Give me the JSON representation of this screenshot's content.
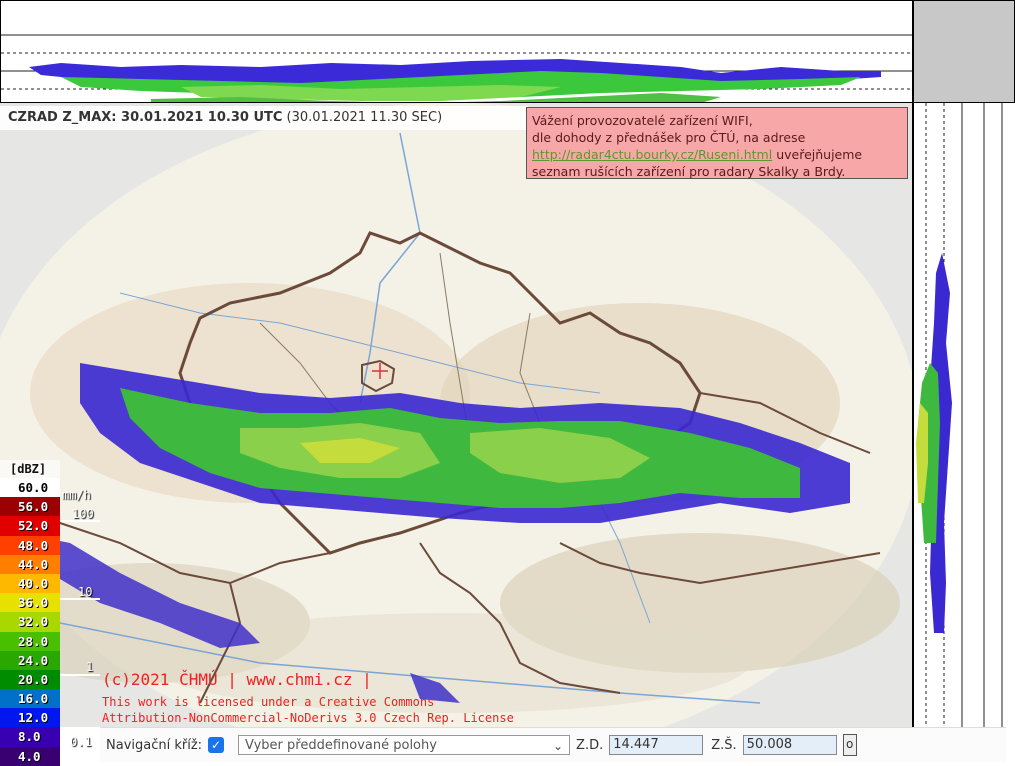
{
  "title": {
    "product": "CZRAD Z_MAX: 30.01.2021 10.30 UTC",
    "local_time": "(30.01.2021 11.30 SEC)"
  },
  "notice": {
    "line1": "Vážení provozovatelé zařízení WIFI,",
    "line2": "dle dohody z přednášek pro ČTÚ, na adrese",
    "link": "http://radar4ctu.bourky.cz/Ruseni.html",
    "line3_suffix": " uveřejňujeme",
    "line4": "seznam rušících zařízení pro radary Skalky a Brdy."
  },
  "legend": {
    "unit": "[dBZ]",
    "items": [
      {
        "label": "60.0",
        "color": "#ffffff",
        "text_color": "#000000"
      },
      {
        "label": "56.0",
        "color": "#9c0000",
        "text_color": "#ffffff"
      },
      {
        "label": "52.0",
        "color": "#e00000",
        "text_color": "#ffffff"
      },
      {
        "label": "48.0",
        "color": "#ff4000",
        "text_color": "#ffffff"
      },
      {
        "label": "44.0",
        "color": "#ff8000",
        "text_color": "#ffffff"
      },
      {
        "label": "40.0",
        "color": "#ffb800",
        "text_color": "#ffffff"
      },
      {
        "label": "36.0",
        "color": "#e8e000",
        "text_color": "#ffffff"
      },
      {
        "label": "32.0",
        "color": "#a8d800",
        "text_color": "#ffffff"
      },
      {
        "label": "28.0",
        "color": "#48c000",
        "text_color": "#ffffff"
      },
      {
        "label": "24.0",
        "color": "#28a800",
        "text_color": "#ffffff"
      },
      {
        "label": "20.0",
        "color": "#008c00",
        "text_color": "#ffffff"
      },
      {
        "label": "16.0",
        "color": "#0070c8",
        "text_color": "#ffffff"
      },
      {
        "label": "12.0",
        "color": "#0018f0",
        "text_color": "#ffffff"
      },
      {
        "label": "8.0",
        "color": "#3800b0",
        "text_color": "#ffffff"
      },
      {
        "label": "4.0",
        "color": "#380070",
        "text_color": "#ffffff"
      }
    ]
  },
  "rain_scale": {
    "unit": "mm/h",
    "labels": [
      "100",
      "10",
      "1",
      "0.1"
    ]
  },
  "copyright": "(c)2021 ČHMÚ | www.chmi.cz |",
  "license_line1": "This work is licensed under a Creative Commons",
  "license_line2": "Attribution-NonCommercial-NoDerivs 3.0 Czech Rep. License",
  "nav": {
    "label": "Navigační kříž:",
    "checked": true,
    "select_value": "Vyber předdefinované polohy",
    "zd_label": "Z.D.",
    "zd_value": "14.447",
    "zs_label": "Z.Š.",
    "zs_value": "50.008",
    "go_label": "o"
  },
  "colors": {
    "border": "#6b4a3a",
    "notice_bg": "#f7a7a7",
    "link": "#5a9a2a",
    "copyright": "#ee2222"
  }
}
